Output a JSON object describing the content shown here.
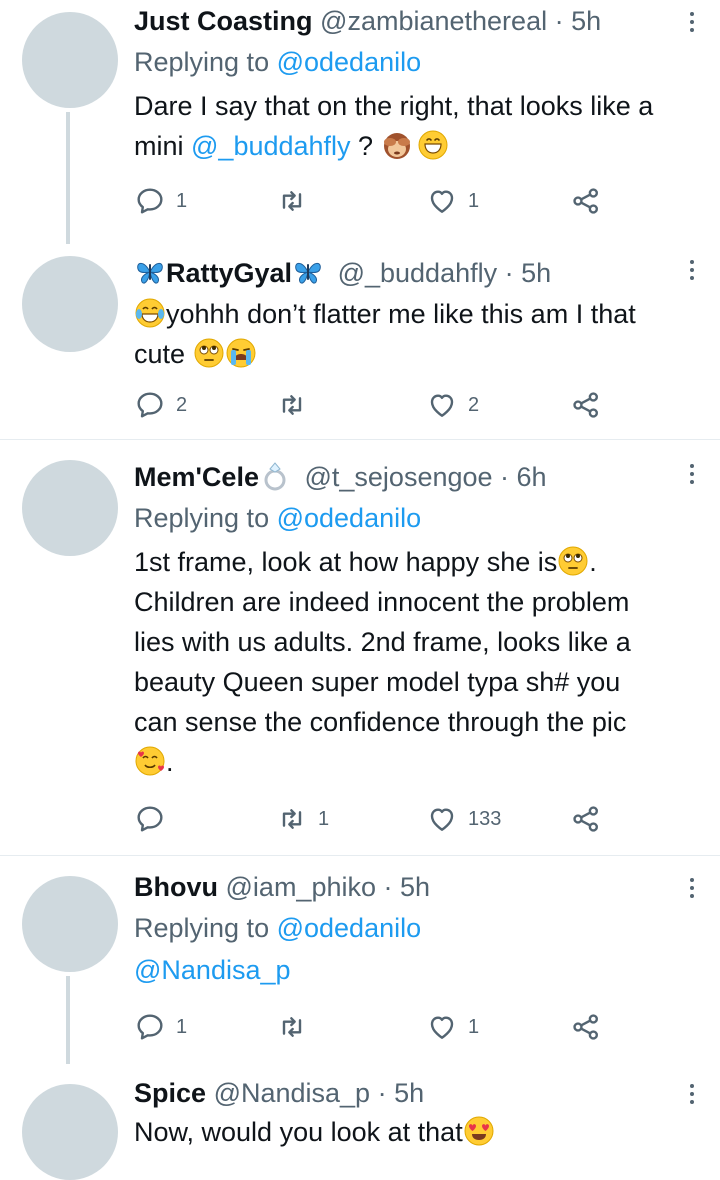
{
  "tweets": [
    {
      "name": "Just Coasting",
      "handle": "@zambianethereal",
      "time": "· 5h",
      "replying_prefix": "Replying to ",
      "replying_handle": "@odedanilo",
      "text_1": "Dare I say that on the right, that looks like a mini ",
      "mention": "@_buddahfly",
      "text_2": " ? ",
      "emoji_1": "see-no-evil-monkey",
      "emoji_2": "grinning-face",
      "replies": "1",
      "retweets": "",
      "likes": "1"
    },
    {
      "name_prefix_emoji": "butterfly",
      "name": "RattyGyal",
      "name_suffix_emoji": "butterfly",
      "handle": "@_buddahfly",
      "time": "· 5h",
      "emoji_lead": "face-with-tears-of-joy",
      "text_1": "yohhh don’t flatter me like this am I that cute ",
      "emoji_1": "face-with-rolling-eyes",
      "emoji_2": "loudly-crying-face",
      "replies": "2",
      "retweets": "",
      "likes": "2"
    },
    {
      "name": "Mem'Cele",
      "name_suffix_emoji": "ring",
      "handle": "@t_sejosengoe",
      "time": "· 6h",
      "replying_prefix": "Replying to ",
      "replying_handle": "@odedanilo",
      "lines": [
        "1st frame, look at how happy she is",
        "Children are indeed innocent the problem",
        "lies with us adults. 2nd frame, looks like a",
        "beauty Queen super model typa sh# you",
        "can sense the confidence through the pic"
      ],
      "line1_tail": ".",
      "last_tail": ".",
      "emoji_1": "face-with-rolling-eyes",
      "emoji_2": "smiling-face-with-hearts",
      "replies": "",
      "retweets": "1",
      "likes": "133"
    },
    {
      "name": "Bhovu",
      "handle": "@iam_phiko",
      "time": "· 5h",
      "replying_prefix": "Replying to ",
      "replying_handle": "@odedanilo",
      "mention": "@Nandisa_p",
      "replies": "1",
      "retweets": "",
      "likes": "1"
    },
    {
      "name": "Spice",
      "handle": "@Nandisa_p",
      "time": "· 5h",
      "text_1": "Now, would you look at that",
      "emoji_1": "smiling-face-with-heart-eyes"
    }
  ],
  "icons": {
    "reply": "reply-icon",
    "retweet": "retweet-icon",
    "like": "heart-icon",
    "share": "share-icon",
    "more": "more-vertical-icon"
  },
  "colors": {
    "link": "#1d9bf0",
    "muted": "#536471",
    "avatar": "#cfd9de",
    "divider": "#e6ecf0"
  }
}
